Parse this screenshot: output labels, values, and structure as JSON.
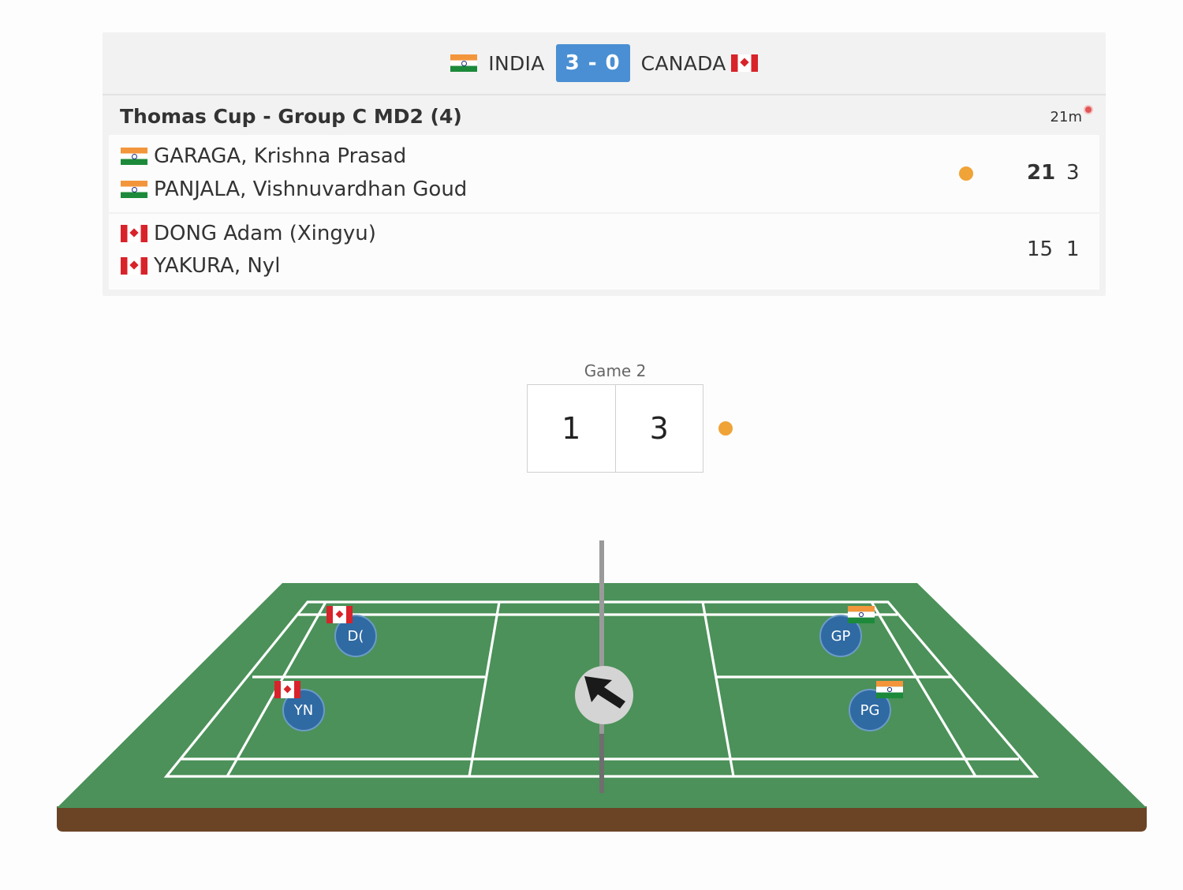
{
  "tie": {
    "team_a": "INDIA",
    "team_b": "CANADA",
    "score": "3 - 0",
    "team_a_flag": "india-flag",
    "team_b_flag": "canada-flag"
  },
  "match": {
    "title": "Thomas Cup - Group C MD2 (4)",
    "duration": "21m",
    "pair_a": {
      "players": [
        "GARAGA, Krishna Prasad",
        "PANJALA, Vishnuvardhan Goud"
      ],
      "game1": "21",
      "game2": "3",
      "serving": true
    },
    "pair_b": {
      "players": [
        "DONG Adam (Xingyu)",
        "YAKURA, Nyl"
      ],
      "game1": "15",
      "game2": "1",
      "serving": false
    }
  },
  "current_game": {
    "label": "Game 2",
    "left_score": "1",
    "right_score": "3"
  },
  "court": {
    "markers": [
      {
        "initials": "D(",
        "flag": "canada-flag"
      },
      {
        "initials": "YN",
        "flag": "canada-flag"
      },
      {
        "initials": "GP",
        "flag": "india-flag"
      },
      {
        "initials": "PG",
        "flag": "india-flag"
      }
    ],
    "shuttle_direction_icon": "arrow-up-left-icon",
    "colors": {
      "court_green": "#4b9159",
      "court_base": "#6b4426",
      "marker_blue": "#2f6aa3",
      "serve_orange": "#f0a337",
      "score_blue": "#4a8fd3"
    }
  }
}
